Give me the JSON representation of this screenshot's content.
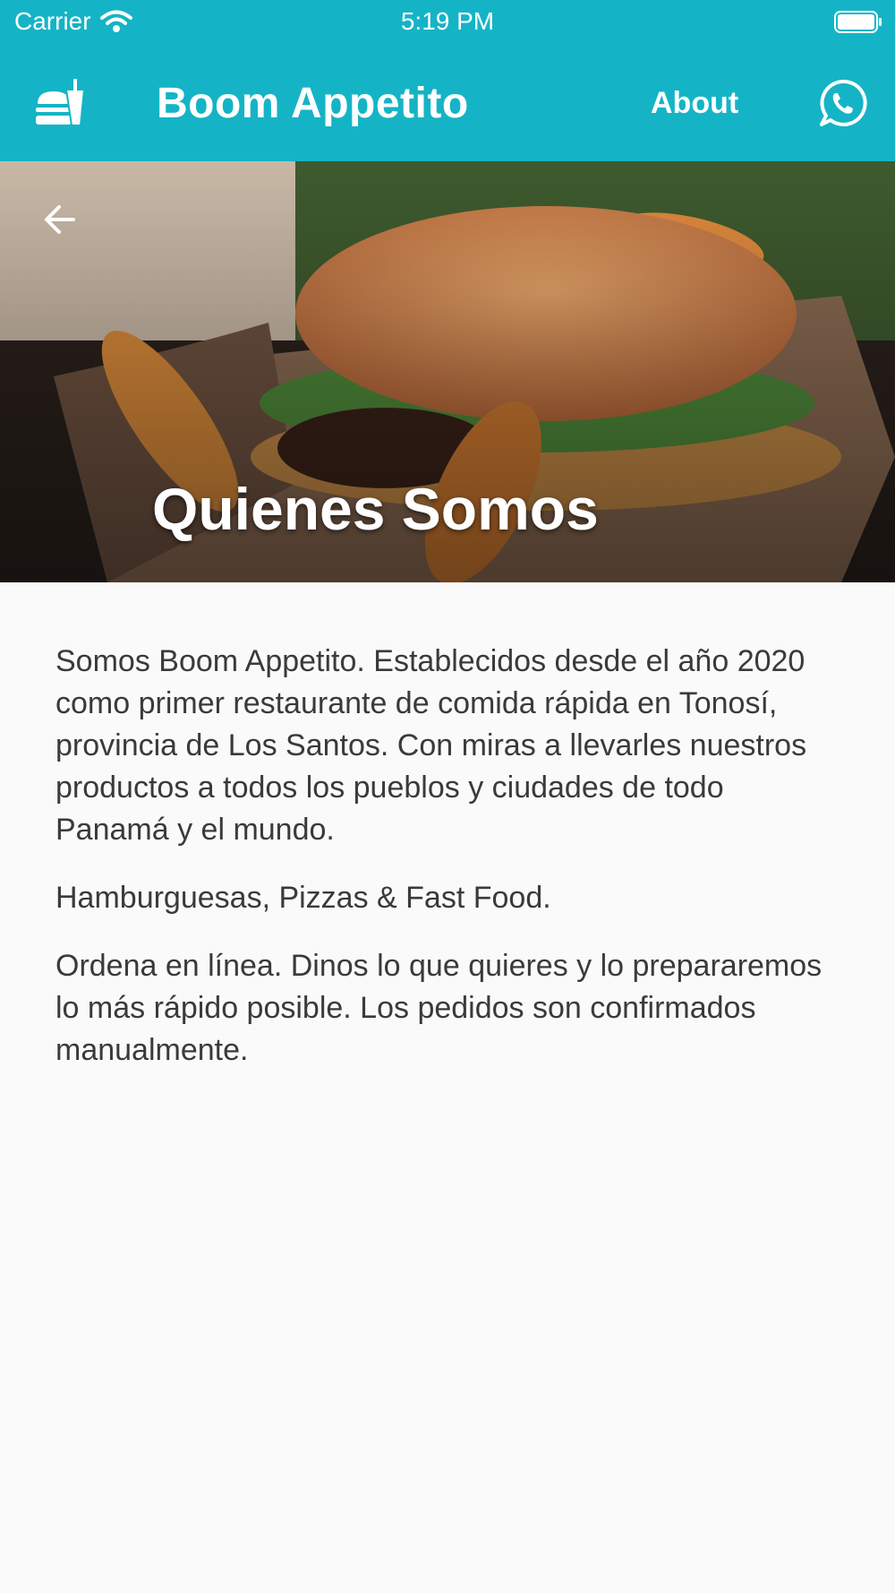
{
  "status_bar": {
    "carrier": "Carrier",
    "time": "5:19 PM"
  },
  "app_bar": {
    "title": "Boom Appetito",
    "about_label": "About",
    "menu_icon": "fast-food-icon",
    "whatsapp_icon": "whatsapp-icon",
    "background": "#14b4c6"
  },
  "hero": {
    "title": "Quienes Somos",
    "back_icon": "arrow-left-icon"
  },
  "content": {
    "paragraphs": [
      "Somos Boom Appetito. Establecidos desde el año 2020 como primer restaurante de comida rápida en Tonosí, provincia de Los Santos. Con miras a llevarles nuestros productos a todos los pueblos y ciudades de todo Panamá y el mundo.",
      "Hamburguesas, Pizzas & Fast Food.",
      "Ordena en línea. Dinos lo que quieres y lo prepararemos lo más rápido posible. Los pedidos son confirmados manualmente."
    ]
  }
}
